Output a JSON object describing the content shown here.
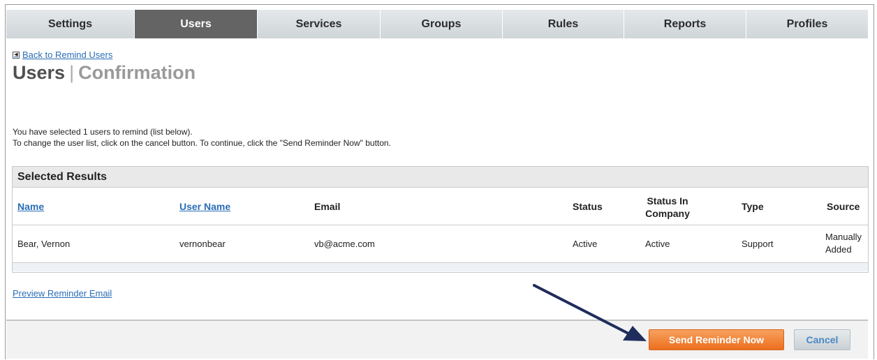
{
  "tabs": [
    {
      "label": "Settings",
      "active": false
    },
    {
      "label": "Users",
      "active": true
    },
    {
      "label": "Services",
      "active": false
    },
    {
      "label": "Groups",
      "active": false
    },
    {
      "label": "Rules",
      "active": false
    },
    {
      "label": "Reports",
      "active": false
    },
    {
      "label": "Profiles",
      "active": false
    }
  ],
  "back_link": {
    "label": "Back to Remind Users",
    "icon": "arrow-left-icon"
  },
  "title": {
    "primary": "Users",
    "separator": "|",
    "secondary": "Confirmation"
  },
  "intro": {
    "line1": "You have selected 1 users to remind (list below).",
    "line2": "To change the user list, click on the cancel button. To continue, click the \"Send Reminder Now\" button."
  },
  "results": {
    "header": "Selected Results",
    "columns": {
      "name": "Name",
      "username": "User Name",
      "email": "Email",
      "status": "Status",
      "status_in_company_1": "Status In",
      "status_in_company_2": "Company",
      "type": "Type",
      "source": "Source"
    },
    "rows": [
      {
        "name": "Bear, Vernon",
        "username": "vernonbear",
        "email": "vb@acme.com",
        "status": "Active",
        "status_in_company": "Active",
        "type": "Support",
        "source_1": "Manually",
        "source_2": "Added"
      }
    ]
  },
  "preview_link": "Preview Reminder Email",
  "buttons": {
    "send": "Send Reminder Now",
    "cancel": "Cancel"
  },
  "colors": {
    "accent_orange": "#ec6f1e",
    "link_blue": "#2a6db5",
    "active_tab": "#646464",
    "annotation_arrow": "#1f2d5c"
  }
}
